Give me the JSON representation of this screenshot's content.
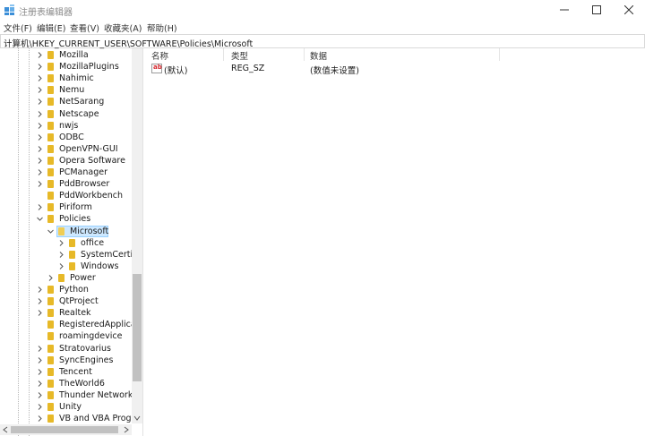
{
  "window": {
    "title": "注册表编辑器"
  },
  "menu": [
    "文件(F)",
    "编辑(E)",
    "查看(V)",
    "收藏夹(A)",
    "帮助(H)"
  ],
  "address": "计算机\\HKEY_CURRENT_USER\\SOFTWARE\\Policies\\Microsoft",
  "tree": [
    {
      "label": "Mozilla",
      "level": 0,
      "expander": "collapsed"
    },
    {
      "label": "MozillaPlugins",
      "level": 0,
      "expander": "collapsed"
    },
    {
      "label": "Nahimic",
      "level": 0,
      "expander": "collapsed"
    },
    {
      "label": "Nemu",
      "level": 0,
      "expander": "collapsed"
    },
    {
      "label": "NetSarang",
      "level": 0,
      "expander": "collapsed"
    },
    {
      "label": "Netscape",
      "level": 0,
      "expander": "collapsed"
    },
    {
      "label": "nwjs",
      "level": 0,
      "expander": "collapsed"
    },
    {
      "label": "ODBC",
      "level": 0,
      "expander": "collapsed"
    },
    {
      "label": "OpenVPN-GUI",
      "level": 0,
      "expander": "collapsed"
    },
    {
      "label": "Opera Software",
      "level": 0,
      "expander": "collapsed"
    },
    {
      "label": "PCManager",
      "level": 0,
      "expander": "collapsed"
    },
    {
      "label": "PddBrowser",
      "level": 0,
      "expander": "collapsed"
    },
    {
      "label": "PddWorkbench",
      "level": 0,
      "expander": "none"
    },
    {
      "label": "Piriform",
      "level": 0,
      "expander": "collapsed"
    },
    {
      "label": "Policies",
      "level": 0,
      "expander": "expanded"
    },
    {
      "label": "Microsoft",
      "level": 1,
      "expander": "expanded",
      "selected": true
    },
    {
      "label": "office",
      "level": 2,
      "expander": "collapsed"
    },
    {
      "label": "SystemCertificates",
      "level": 2,
      "expander": "collapsed"
    },
    {
      "label": "Windows",
      "level": 2,
      "expander": "collapsed"
    },
    {
      "label": "Power",
      "level": 1,
      "expander": "collapsed"
    },
    {
      "label": "Python",
      "level": 0,
      "expander": "collapsed"
    },
    {
      "label": "QtProject",
      "level": 0,
      "expander": "collapsed"
    },
    {
      "label": "Realtek",
      "level": 0,
      "expander": "collapsed"
    },
    {
      "label": "RegisteredApplications",
      "level": 0,
      "expander": "none"
    },
    {
      "label": "roamingdevice",
      "level": 0,
      "expander": "none"
    },
    {
      "label": "Stratovarius",
      "level": 0,
      "expander": "collapsed"
    },
    {
      "label": "SyncEngines",
      "level": 0,
      "expander": "collapsed"
    },
    {
      "label": "Tencent",
      "level": 0,
      "expander": "collapsed"
    },
    {
      "label": "TheWorld6",
      "level": 0,
      "expander": "collapsed"
    },
    {
      "label": "Thunder Network",
      "level": 0,
      "expander": "collapsed"
    },
    {
      "label": "Unity",
      "level": 0,
      "expander": "collapsed"
    },
    {
      "label": "VB and VBA Program Settings",
      "level": 0,
      "expander": "collapsed"
    }
  ],
  "list": {
    "columns": [
      "名称",
      "类型",
      "数据"
    ],
    "rows": [
      {
        "name": "(默认)",
        "type": "REG_SZ",
        "data": "(数值未设置)",
        "icon": "reg-sz-icon"
      }
    ]
  },
  "colors": {
    "folder": "#e7b928",
    "selection": "#cde8ff",
    "icon_accent": "#d4262c"
  }
}
